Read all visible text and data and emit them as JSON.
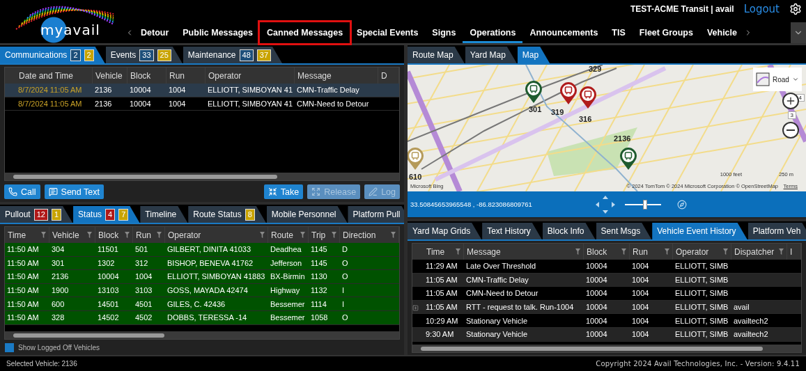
{
  "header": {
    "logo": "myavail",
    "account": "TEST-ACME Transit | avail",
    "logout": "Logout"
  },
  "nav": {
    "tabs": [
      {
        "label": "Detour",
        "selected": false,
        "highlighted": false
      },
      {
        "label": "Public Messages",
        "selected": false,
        "highlighted": false
      },
      {
        "label": "Canned Messages",
        "selected": false,
        "highlighted": true
      },
      {
        "label": "Special Events",
        "selected": false,
        "highlighted": false
      },
      {
        "label": "Signs",
        "selected": false,
        "highlighted": false
      },
      {
        "label": "Operations",
        "selected": true,
        "highlighted": false
      },
      {
        "label": "Announcements",
        "selected": false,
        "highlighted": false
      },
      {
        "label": "TIS",
        "selected": false,
        "highlighted": false
      },
      {
        "label": "Fleet Groups",
        "selected": false,
        "highlighted": false
      },
      {
        "label": "Vehicle",
        "selected": false,
        "highlighted": false
      }
    ]
  },
  "communications_panel": {
    "tabs": [
      {
        "label": "Communications",
        "selected": true,
        "badges": [
          {
            "count": "2",
            "color": "#1d4f7a"
          },
          {
            "count": "2",
            "color": "#c9a400"
          }
        ]
      },
      {
        "label": "Events",
        "selected": false,
        "badges": [
          {
            "count": "33",
            "color": "#1d4f7a"
          },
          {
            "count": "25",
            "color": "#c9a400"
          }
        ]
      },
      {
        "label": "Maintenance",
        "selected": false,
        "badges": [
          {
            "count": "48",
            "color": "#1d4f7a"
          },
          {
            "count": "37",
            "color": "#c9a400"
          }
        ]
      }
    ],
    "table": {
      "columns": [
        "Date and Time",
        "Vehicle",
        "Block",
        "Run",
        "Operator",
        "Message",
        "D"
      ],
      "rows": [
        {
          "selected": true,
          "cells": [
            "8/7/2024 11:05 AM",
            "2136",
            "10004",
            "1004",
            "ELLIOTT, SIMBOYAN 41",
            "CMN-Traffic Delay"
          ]
        },
        {
          "selected": false,
          "cells": [
            "8/7/2024 11:05 AM",
            "2136",
            "10004",
            "1004",
            "ELLIOTT, SIMBOYAN 41",
            "CMN-Need to Detour"
          ]
        }
      ]
    },
    "buttons": [
      {
        "kind": "call",
        "label": "Call",
        "disabled": false
      },
      {
        "kind": "text",
        "label": "Send Text",
        "disabled": false
      },
      {
        "kind": "take",
        "label": "Take",
        "disabled": false
      },
      {
        "kind": "release",
        "label": "Release",
        "disabled": true
      },
      {
        "kind": "log",
        "label": "Log",
        "disabled": true
      }
    ]
  },
  "status_panel": {
    "tabs": [
      {
        "label": "Pullout",
        "selected": false,
        "badges": [
          {
            "count": "12",
            "color": "#b01818"
          },
          {
            "count": "1",
            "color": "#c9a400"
          }
        ]
      },
      {
        "label": "Status",
        "selected": true,
        "badges": [
          {
            "count": "4",
            "color": "#b01818"
          },
          {
            "count": "7",
            "color": "#c9a400"
          }
        ]
      },
      {
        "label": "Timeline",
        "selected": false
      },
      {
        "label": "Route Status",
        "selected": false,
        "badges": [
          {
            "count": "8",
            "color": "#c9a400"
          }
        ]
      },
      {
        "label": "Mobile Personnel",
        "selected": false
      },
      {
        "label": "Platform Pull",
        "selected": false
      }
    ],
    "table": {
      "columns": [
        "Time",
        "Vehicle",
        "Block",
        "Run",
        "Operator",
        "Route",
        "Trip",
        "Direction"
      ],
      "rows": [
        [
          "11:50 AM",
          "304",
          "11501",
          "501",
          "GILBERT, DINITA 41033",
          "Deadhea",
          "1145",
          "D"
        ],
        [
          "11:50 AM",
          "301",
          "1302",
          "312",
          "BISHOP, BENEVA 41762",
          "Jefferson",
          "1145",
          "O"
        ],
        [
          "11:50 AM",
          "2136",
          "10004",
          "1004",
          "ELLIOTT, SIMBOYAN 41883",
          "BX-Birmin",
          "1130",
          "O"
        ],
        [
          "11:50 AM",
          "1900",
          "13103",
          "3103",
          "GOSS, MAYADA 42474",
          "Highway",
          "1132",
          "I"
        ],
        [
          "11:50 AM",
          "600",
          "14501",
          "4501",
          "GILES, C. 42436",
          "Bessemer",
          "1114",
          "I"
        ],
        [
          "11:50 AM",
          "328",
          "14502",
          "4502",
          "DOBBS, TERESSA -14",
          "Bessemer",
          "1058",
          "O"
        ]
      ]
    },
    "show_logged_off": {
      "label": "Show Logged Off Vehicles",
      "checked": true
    }
  },
  "map_panel": {
    "tabs": [
      {
        "label": "Route Map",
        "selected": false
      },
      {
        "label": "Yard Map",
        "selected": false
      },
      {
        "label": "Map",
        "selected": true
      }
    ],
    "map": {
      "markers": [
        {
          "kind": "pin",
          "label": "301",
          "color": "#1e5b2e"
        },
        {
          "kind": "pin",
          "label": "319",
          "color": "#b01c1c"
        },
        {
          "kind": "pin",
          "label": "316",
          "color": "#b01c1c"
        },
        {
          "kind": "pin",
          "label": "2136",
          "color": "#1e5b2e"
        },
        {
          "kind": "pin",
          "label": "610",
          "color": "#b59a5a"
        },
        {
          "kind": "label",
          "label": "329"
        }
      ],
      "style": "Road",
      "heading": "4",
      "zoom_level": "3",
      "scale_feet": "1000 feet",
      "scale_meters": "250 m",
      "provider": "Microsoft Bing",
      "attribution": "© 2024 TomTom © 2024 Microsoft Corporation © OpenStreetMap",
      "terms": "Terms"
    },
    "coordinates": "33.50845653965548 , -86.823086809761",
    "zoom": {
      "level": 0.55
    }
  },
  "history_panel": {
    "tabs": [
      {
        "label": "Yard Map Grids",
        "selected": false
      },
      {
        "label": "Text History",
        "selected": false
      },
      {
        "label": "Block Info",
        "selected": false
      },
      {
        "label": "Sent Msgs",
        "selected": false
      },
      {
        "label": "Vehicle Event History",
        "selected": true
      },
      {
        "label": "Platform Veh",
        "selected": false
      }
    ],
    "table": {
      "columns": [
        "Time",
        "Message",
        "Block",
        "Run",
        "Operator",
        "Dispatcher",
        "I"
      ],
      "rows": [
        {
          "expandable": false,
          "cells": [
            "11:29 AM",
            "Late Over Threshold",
            "10004",
            "1004",
            "ELLIOTT, SIMB",
            ""
          ]
        },
        {
          "expandable": false,
          "cells": [
            "11:05 AM",
            "CMN-Traffic Delay",
            "10004",
            "1004",
            "ELLIOTT, SIMB",
            ""
          ]
        },
        {
          "expandable": false,
          "cells": [
            "11:05 AM",
            "CMN-Need to Detour",
            "10004",
            "1004",
            "ELLIOTT, SIMB",
            ""
          ]
        },
        {
          "expandable": true,
          "cells": [
            "11:05 AM",
            "RTT - request to talk. Run-1004",
            "10004",
            "1004",
            "ELLIOTT, SIMB",
            "avail"
          ]
        },
        {
          "expandable": false,
          "cells": [
            "10:29 AM",
            "Stationary Vehicle",
            "10004",
            "1004",
            "ELLIOTT, SIMB",
            "availtech2"
          ]
        },
        {
          "expandable": false,
          "cells": [
            "9:30 AM",
            "Stationary Vehicle",
            "10004",
            "1004",
            "ELLIOTT, SIMB",
            "availtech2"
          ]
        }
      ]
    }
  },
  "status_bar": {
    "selected_vehicle": "Selected Vehicle: 2136",
    "copyright": "Copyright 2024 Avail Technologies, Inc. - Version: 9.4.11"
  }
}
